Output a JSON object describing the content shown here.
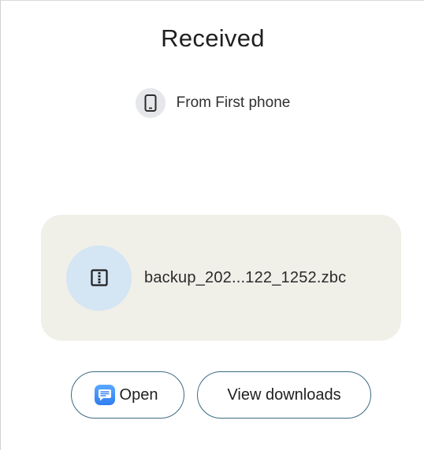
{
  "header": {
    "title": "Received"
  },
  "source": {
    "icon": "phone-icon",
    "text": "From First phone"
  },
  "file": {
    "icon": "zip-file-icon",
    "name": "backup_202...122_1252.zbc"
  },
  "actions": {
    "open_label": "Open",
    "open_icon": "messages-app-icon",
    "view_downloads_label": "View downloads"
  },
  "colors": {
    "card_background": "#f0efe8",
    "file_icon_background": "#d4e5f4",
    "button_border": "#3c6b86"
  }
}
